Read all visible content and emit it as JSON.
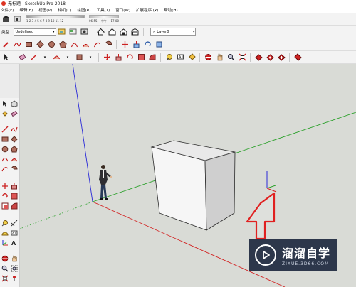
{
  "window": {
    "title": "无标题 - SketchUp Pro 2018"
  },
  "menu": [
    "文件(F)",
    "编辑(E)",
    "视图(V)",
    "相机(C)",
    "绘图(R)",
    "工具(T)",
    "窗口(W)",
    "扩展程序 (x)",
    "帮助(H)"
  ],
  "shadow": {
    "months": "1 2 3 4 5 6 7 8 9 10 11 12",
    "time_start": "06:55",
    "time_mid": "中午",
    "time_end": "17:00"
  },
  "style_bar": {
    "label": "类型：",
    "value": "Undefined"
  },
  "layer": {
    "value": "Layer0"
  },
  "watermark": {
    "title": "溜溜自学",
    "url": "ZIXUE.3D66.COM"
  },
  "colors": {
    "axis_red": "#d22020",
    "axis_green": "#2aa02a",
    "axis_blue": "#2a2ad8",
    "arrow_red": "#e02020",
    "viewport_bg": "#d9dbd6",
    "toolbar_bg": "#f3f3f3"
  }
}
